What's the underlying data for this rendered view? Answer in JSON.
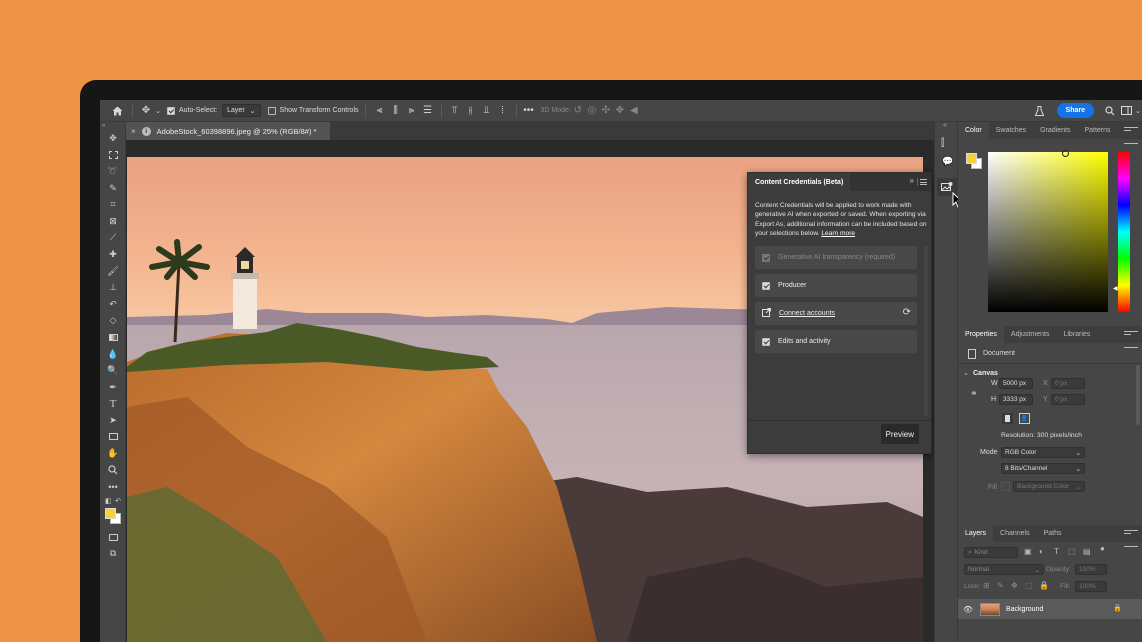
{
  "window": {
    "share_label": "Share"
  },
  "options_bar": {
    "auto_select_label": "Auto-Select:",
    "auto_select_value": "Layer",
    "show_transform_label": "Show Transform Controls",
    "mode_3d_label": "3D Mode:"
  },
  "document_tab": {
    "title": "AdobeStock_60398896.jpeg @ 25% (RGB/8#) *"
  },
  "content_credentials": {
    "tab_label": "Content Credentials (Beta)",
    "description": "Content Credentials will be applied to work made with generative AI when exported or saved. When exporting via Export As, additional information can be included based on your selections below.",
    "learn_more": "Learn more",
    "rows": [
      {
        "label": "Generative AI transparency (required)",
        "checked": true,
        "disabled": true
      },
      {
        "label": "Producer",
        "checked": true,
        "disabled": false
      },
      {
        "label": "Connect accounts",
        "link": true
      },
      {
        "label": "Edits and activity",
        "checked": true,
        "disabled": false
      }
    ],
    "preview_label": "Preview"
  },
  "color_panel": {
    "tabs": [
      "Color",
      "Swatches",
      "Gradients",
      "Patterns"
    ],
    "foreground": "#F4D03F",
    "background": "#FFFFFF",
    "hue_color": "#FFFF00"
  },
  "properties_panel": {
    "tabs": [
      "Properties",
      "Adjustments",
      "Libraries"
    ],
    "doc_label": "Document",
    "canvas_label": "Canvas",
    "w_label": "W",
    "w_value": "5000 px",
    "h_label": "H",
    "h_value": "3333 px",
    "x_label": "X",
    "x_value": "0 px",
    "y_label": "Y",
    "y_value": "0 px",
    "resolution": "Resolution: 300 pixels/inch",
    "mode_label": "Mode",
    "mode_value": "RGB Color",
    "bits_value": "8 Bits/Channel",
    "fill_label": "Fill",
    "fill_value": "Background Color"
  },
  "layers_panel": {
    "tabs": [
      "Layers",
      "Channels",
      "Paths"
    ],
    "kind_label": "Kind",
    "blend_mode": "Normal",
    "opacity_label": "Opacity:",
    "opacity_value": "100%",
    "lock_label": "Lock:",
    "fill_label": "Fill:",
    "fill_value": "100%",
    "layers": [
      {
        "name": "Background",
        "visible": true,
        "locked": true
      }
    ]
  }
}
